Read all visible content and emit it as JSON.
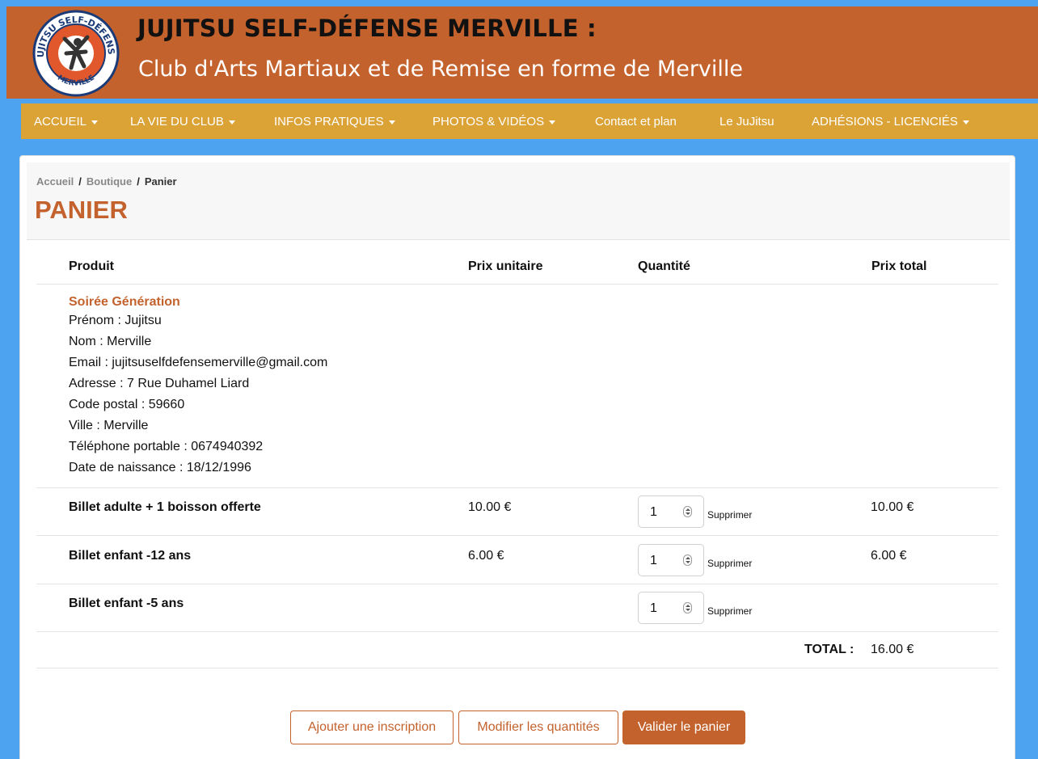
{
  "site": {
    "logo_top_text": "JUJITSU SELF-DÉFENSE",
    "logo_bottom_text": "MERVILLE",
    "title": "JUJITSU SELF-DÉFENSE MERVILLE :",
    "subtitle": "Club d'Arts Martiaux et de Remise en forme de Merville"
  },
  "nav": {
    "items": [
      {
        "label": "ACCUEIL",
        "dropdown": true
      },
      {
        "label": "LA VIE DU CLUB",
        "dropdown": true
      },
      {
        "label": "INFOS PRATIQUES",
        "dropdown": true
      },
      {
        "label": "PHOTOS & VIDÉOS",
        "dropdown": true
      },
      {
        "label": "Contact et plan",
        "dropdown": false
      },
      {
        "label": "Le JuJitsu",
        "dropdown": false
      },
      {
        "label": "ADHÉSIONS - LICENCIÉS",
        "dropdown": true
      }
    ]
  },
  "breadcrumb": {
    "home": "Accueil",
    "sep": "/",
    "shop": "Boutique",
    "current": "Panier"
  },
  "page": {
    "title": "PANIER"
  },
  "table": {
    "headers": {
      "product": "Produit",
      "unit_price": "Prix unitaire",
      "quantity": "Quantité",
      "total_price": "Prix total"
    },
    "event": {
      "name": "Soirée Génération",
      "lines": [
        "Prénom : Jujitsu",
        "Nom : Merville",
        "Email : jujitsuselfdefensemerville@gmail.com",
        "Adresse : 7 Rue Duhamel Liard",
        "Code postal : 59660",
        "Ville : Merville",
        "Téléphone portable : 0674940392",
        "Date de naissance : 18/12/1996"
      ]
    },
    "rows": [
      {
        "name": "Billet adulte + 1 boisson offerte",
        "unit_price": "10.00 €",
        "quantity": "1",
        "remove": "Supprimer",
        "total": "10.00 €"
      },
      {
        "name": "Billet enfant -12 ans",
        "unit_price": "6.00 €",
        "quantity": "1",
        "remove": "Supprimer",
        "total": "6.00 €"
      },
      {
        "name": "Billet enfant -5 ans",
        "unit_price": "",
        "quantity": "1",
        "remove": "Supprimer",
        "total": ""
      }
    ],
    "total_label": "TOTAL :",
    "total_value": "16.00 €"
  },
  "buttons": {
    "add": "Ajouter une inscription",
    "modify": "Modifier les quantités",
    "validate": "Valider le panier"
  },
  "colors": {
    "header": "#c4622d",
    "nav": "#dba236",
    "background": "#4da3f0",
    "accent": "#c4622d"
  },
  "icons": {
    "nav_dropdown": "caret-down-icon",
    "quantity_spinner": "spinner-icon"
  }
}
